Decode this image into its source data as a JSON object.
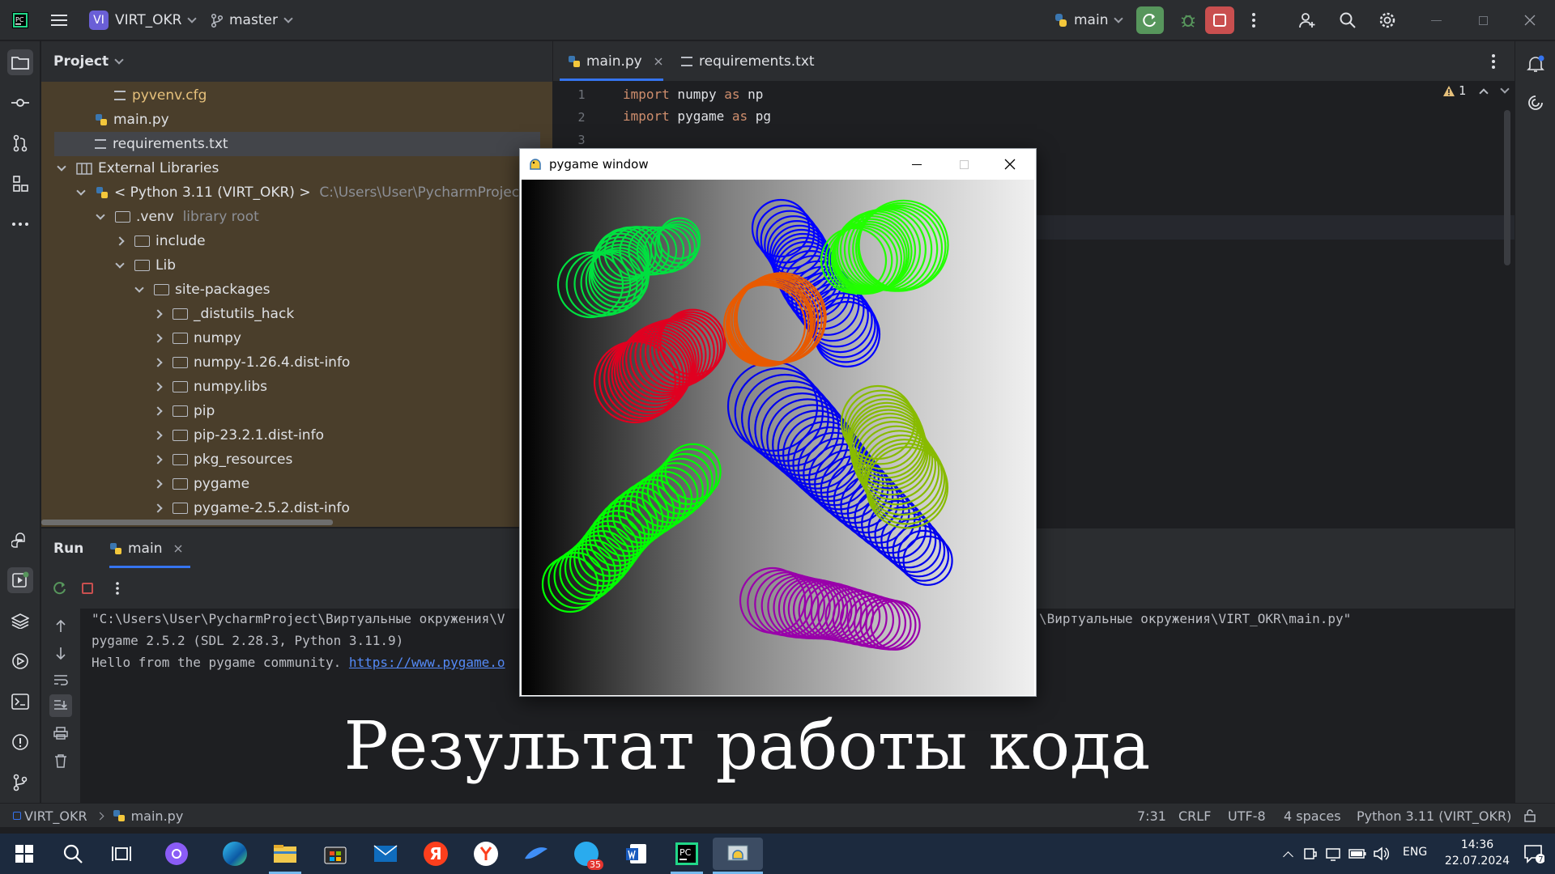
{
  "titlebar": {
    "project_badge": "VI",
    "project_name": "VIRT_OKR",
    "branch": "master",
    "run_config": "main"
  },
  "project_panel": {
    "title": "Project",
    "items": [
      {
        "label": "pyvenv.cfg"
      },
      {
        "label": "main.py"
      },
      {
        "label": "requirements.txt"
      },
      {
        "label": "External Libraries"
      },
      {
        "label": "< Python 3.11 (VIRT_OKR) >",
        "hint": "C:\\Users\\User\\PycharmProject\\Вирт"
      },
      {
        "label": ".venv",
        "hint": "library root"
      },
      {
        "label": "include"
      },
      {
        "label": "Lib"
      },
      {
        "label": "site-packages"
      },
      {
        "label": "_distutils_hack"
      },
      {
        "label": "numpy"
      },
      {
        "label": "numpy-1.26.4.dist-info"
      },
      {
        "label": "numpy.libs"
      },
      {
        "label": "pip"
      },
      {
        "label": "pip-23.2.1.dist-info"
      },
      {
        "label": "pkg_resources"
      },
      {
        "label": "pygame"
      },
      {
        "label": "pygame-2.5.2.dist-info"
      }
    ]
  },
  "editor": {
    "tabs": [
      {
        "label": "main.py"
      },
      {
        "label": "requirements.txt"
      }
    ],
    "warning_count": "1",
    "line_numbers": [
      "1",
      "2",
      "3"
    ],
    "lines": [
      {
        "kw1": "import",
        "mod": " numpy ",
        "kw2": "as",
        "alias": " np"
      },
      {
        "kw1": "import",
        "mod": " pygame ",
        "kw2": "as",
        "alias": " pg"
      }
    ]
  },
  "run_panel": {
    "tab_run": "Run",
    "tab_main": "main",
    "console": {
      "line1_left": "\"C:\\Users\\User\\PycharmProject\\Виртуальные окружения\\V",
      "line1_right": "\\Виртуальные окружения\\VIRT_OKR\\main.py\"",
      "line2": "pygame 2.5.2 (SDL 2.28.3, Python 3.11.9)",
      "line3_text": "Hello from the pygame community. ",
      "line3_link": "https://www.pygame.o"
    }
  },
  "pygame_window": {
    "title": "pygame window"
  },
  "caption": "Результат работы кода",
  "statusbar": {
    "project": "VIRT_OKR",
    "file": "main.py",
    "position": "7:31",
    "line_sep": "CRLF",
    "encoding": "UTF-8",
    "indent": "4 spaces",
    "interpreter": "Python 3.11 (VIRT_OKR)"
  },
  "taskbar": {
    "lang": "ENG",
    "time": "14:36",
    "date": "22.07.2024",
    "notif_count": "7",
    "badge_35": "35"
  },
  "colors": {
    "accent": "#3574f0",
    "tree_bg": "#4a3e2b",
    "run_green": "#57965c",
    "stop_red": "#c94f4f",
    "config_yellow": "#e5c07b"
  }
}
